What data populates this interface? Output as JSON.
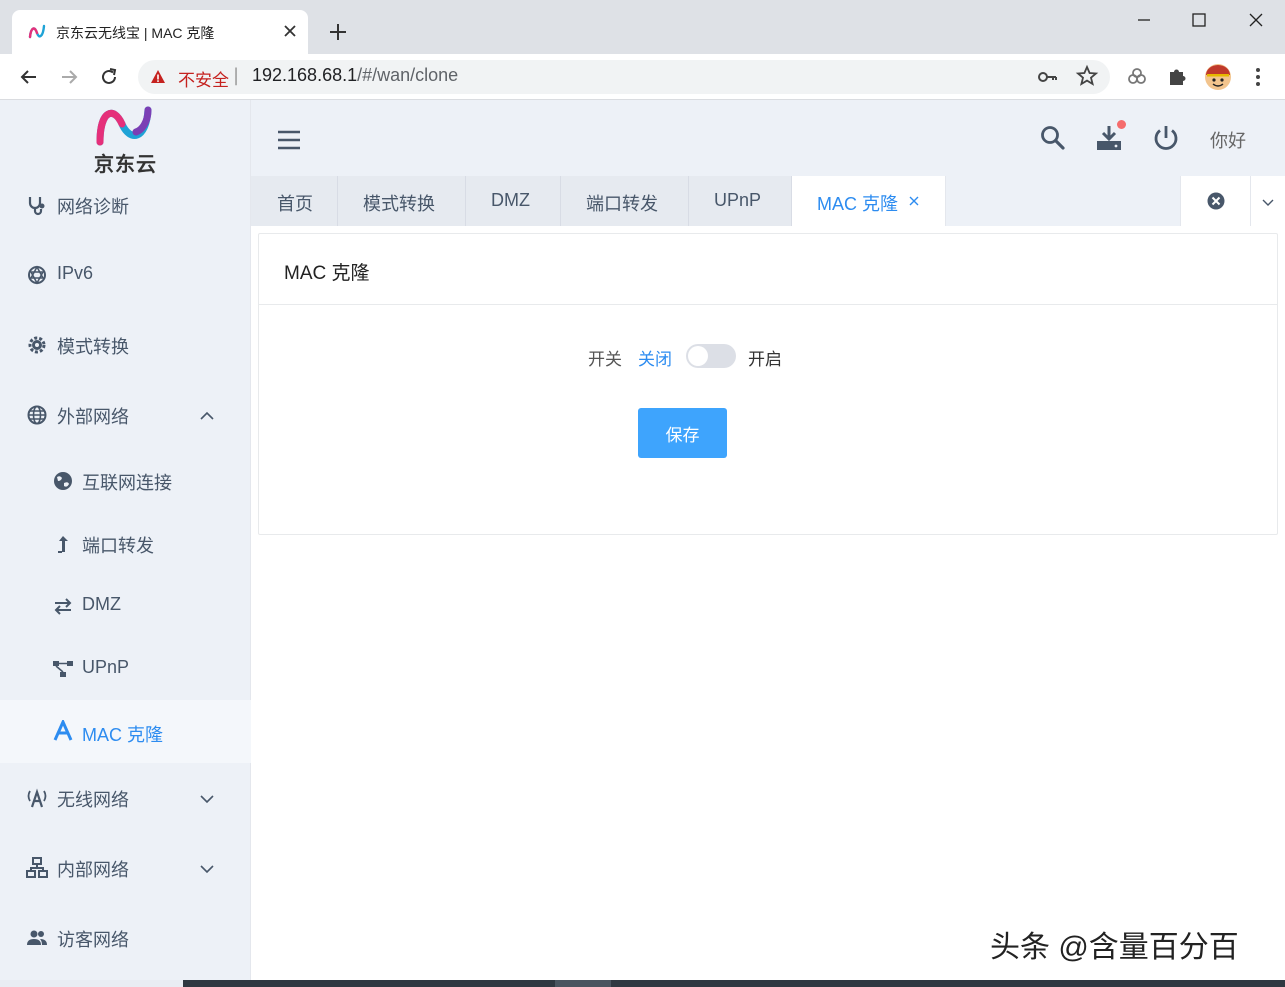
{
  "browser": {
    "tab_title": "京东云无线宝 | MAC 克隆",
    "insecure_label": "不安全",
    "url_host": "192.168.68.1",
    "url_path": "/#/wan/clone"
  },
  "logo": {
    "text": "京东云"
  },
  "sidebar": {
    "items": [
      {
        "label": "网络诊断",
        "icon": "stethoscope-icon"
      },
      {
        "label": "IPv6",
        "icon": "network-icon"
      },
      {
        "label": "模式转换",
        "icon": "gear-icon"
      },
      {
        "label": "外部网络",
        "icon": "globe-icon",
        "expanded": true
      },
      {
        "label": "互联网连接",
        "icon": "earth-icon"
      },
      {
        "label": "端口转发",
        "icon": "arrow-up-icon"
      },
      {
        "label": "DMZ",
        "icon": "swap-icon"
      },
      {
        "label": "UPnP",
        "icon": "topology-icon"
      },
      {
        "label": "MAC 克隆",
        "icon": "letter-a-icon",
        "active": true
      },
      {
        "label": "无线网络",
        "icon": "antenna-icon"
      },
      {
        "label": "内部网络",
        "icon": "lan-icon"
      },
      {
        "label": "访客网络",
        "icon": "users-icon"
      }
    ]
  },
  "header": {
    "greeting": "你好"
  },
  "tabs": [
    {
      "label": "首页"
    },
    {
      "label": "模式转换"
    },
    {
      "label": "DMZ"
    },
    {
      "label": "端口转发"
    },
    {
      "label": "UPnP"
    },
    {
      "label": "MAC 克隆",
      "active": true
    }
  ],
  "card": {
    "title": "MAC 克隆",
    "switch_label": "开关",
    "off_label": "关闭",
    "on_label": "开启",
    "switch_on": false,
    "save_label": "保存"
  },
  "watermark": "头条 @含量百分百",
  "colors": {
    "accent": "#2d8cf0",
    "button": "#3ea4fd",
    "sidebar_bg": "#edf1f7",
    "insecure": "#c5221f"
  }
}
